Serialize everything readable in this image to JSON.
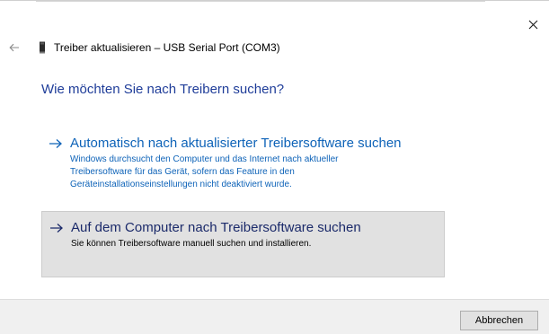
{
  "window": {
    "title": "Treiber aktualisieren – USB Serial Port (COM3)",
    "close_icon": "close-icon",
    "back_icon": "back-arrow-icon",
    "device_icon": "usb-device-icon"
  },
  "question": "Wie möchten Sie nach Treibern suchen?",
  "options": [
    {
      "title": "Automatisch nach aktualisierter Treibersoftware suchen",
      "description": "Windows durchsucht den Computer und das Internet nach aktueller\nTreibersoftware für das Gerät, sofern das Feature in den\nGeräteinstallationseinstellungen nicht deaktiviert wurde.",
      "icon": "arrow-right-icon"
    },
    {
      "title": "Auf dem Computer nach Treibersoftware suchen",
      "description": "Sie können Treibersoftware manuell suchen und installieren.",
      "icon": "arrow-right-icon"
    }
  ],
  "footer": {
    "cancel_label": "Abbrechen"
  },
  "colors": {
    "heading_blue": "#1f3d99",
    "link_blue": "#0e63b8",
    "selected_option_bg": "#e1e1e1",
    "footer_bg": "#f0f0f0"
  }
}
